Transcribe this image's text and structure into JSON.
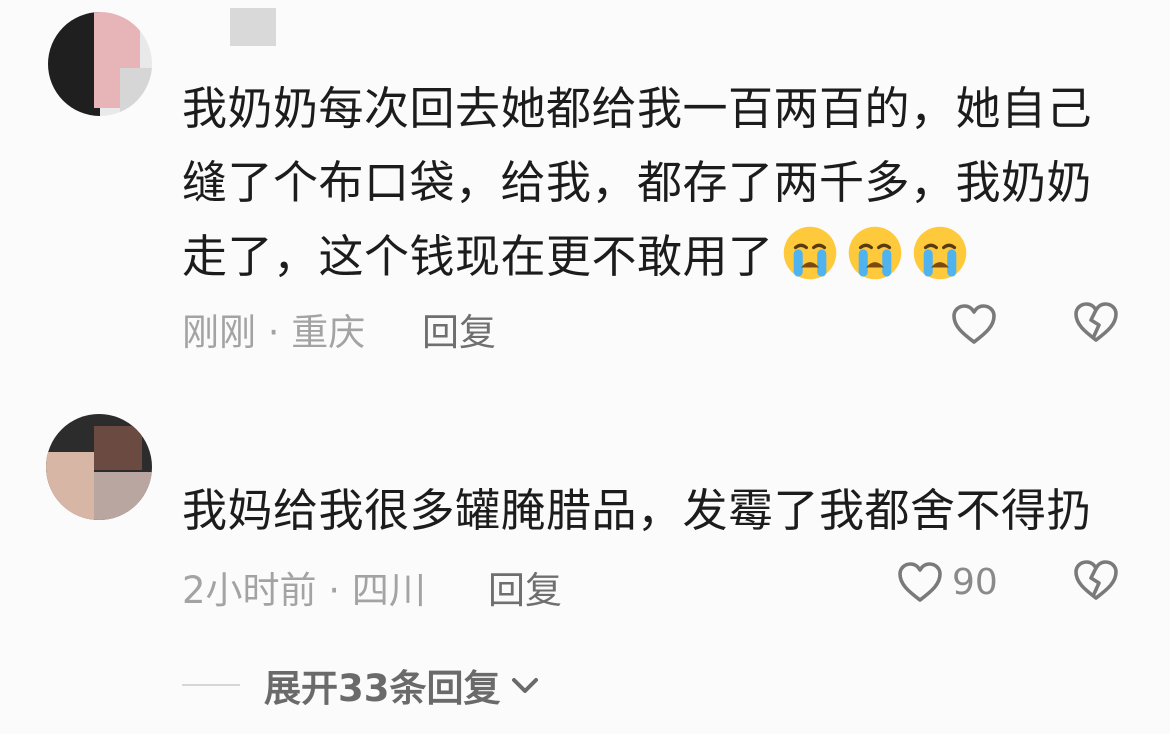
{
  "comments": [
    {
      "text": "我奶奶每次回去她都给我一百两百的，她自己缝了个布口袋，给我，都存了两千多，我奶奶走了，这个钱现在更不敢用了",
      "emojis": [
        "loudly-crying-face",
        "loudly-crying-face",
        "loudly-crying-face"
      ],
      "meta": "刚刚 · 重庆",
      "reply_label": "回复",
      "like_count": ""
    },
    {
      "text": "我妈给我很多罐腌腊品，发霉了我都舍不得扔",
      "emojis": [],
      "meta": "2小时前 · 四川",
      "reply_label": "回复",
      "like_count": "90"
    }
  ],
  "expand_replies_label": "展开33条回复",
  "colors": {
    "text": "#1c1c1c",
    "meta": "#a3a3a3",
    "icon": "#7a7a7a",
    "background": "#fbfbfb"
  },
  "icons": [
    "heart-outline-icon",
    "broken-heart-icon",
    "chevron-down-icon",
    "loudly-crying-face-emoji"
  ]
}
